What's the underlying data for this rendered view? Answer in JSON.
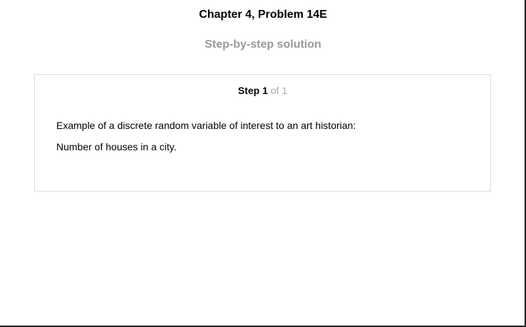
{
  "header": {
    "title": "Chapter 4, Problem 14E",
    "subtitle": "Step-by-step solution"
  },
  "step": {
    "label": "Step 1",
    "of": "of 1",
    "lines": [
      "Example of a discrete random variable of interest to an art historian:",
      "Number of houses in a city."
    ]
  }
}
